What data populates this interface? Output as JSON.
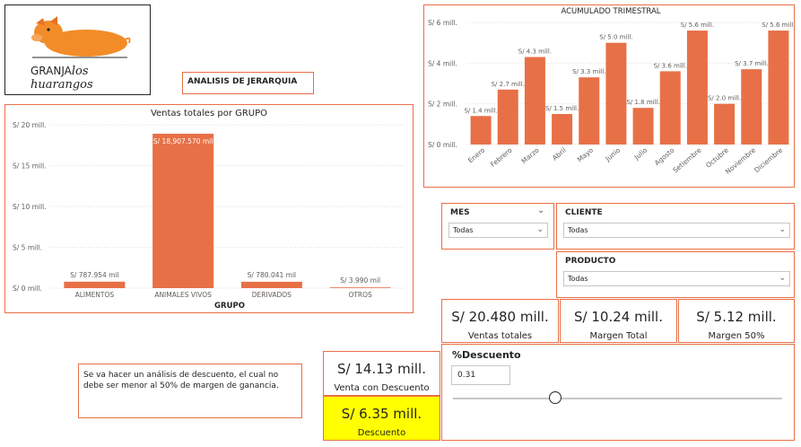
{
  "logo": {
    "brand_prefix": "GRANJA",
    "brand_name": "los huarangos"
  },
  "heading": "ANALISIS DE JERARQUIA",
  "bar_chart_grupo": {
    "title": "Ventas totales por GRUPO",
    "xlabel": "GRUPO",
    "y_ticks": [
      "S/ 0 mill.",
      "S/ 5 mill.",
      "S/ 10 mill.",
      "S/ 15 mill.",
      "S/ 20 mill."
    ],
    "data_labels": [
      "S/ 787.954 mil",
      "S/ 18,907.570 mil",
      "S/ 780.041 mil",
      "S/ 3.990 mil"
    ]
  },
  "bar_chart_mes": {
    "title": "ACUMULADO TRIMESTRAL",
    "y_ticks": [
      "S/ 0 mill.",
      "S/ 2 mill.",
      "S/ 4 mill.",
      "S/ 6 mill."
    ],
    "data_labels": [
      "S/ 1.4 mill.",
      "S/ 2.7 mill.",
      "S/ 4.3 mill.",
      "S/ 1.5 mill.",
      "S/ 3.3 mill.",
      "S/ 5.0 mill.",
      "S/ 1.8 mill.",
      "S/ 3.6 mill.",
      "S/ 5.6 mill.",
      "S/ 2.0 mill.",
      "S/ 3.7 mill.",
      "S/ 5.6 mill."
    ]
  },
  "chart_data": [
    {
      "type": "bar",
      "title": "Ventas totales por GRUPO",
      "xlabel": "GRUPO",
      "ylabel": "",
      "categories": [
        "ALIMENTOS",
        "ANIMALES VIVOS",
        "DERIVADOS",
        "OTROS"
      ],
      "values": [
        0.787954,
        18.90757,
        0.780041,
        0.00399
      ],
      "unit": "S/ mill.",
      "ylim": [
        0,
        20
      ],
      "grid": true,
      "color": "#e87046"
    },
    {
      "type": "bar",
      "title": "ACUMULADO TRIMESTRAL",
      "xlabel": "",
      "ylabel": "",
      "categories": [
        "Enero",
        "Febrero",
        "Marzo",
        "Abril",
        "Mayo",
        "Junio",
        "Julio",
        "Agosto",
        "Setiembre",
        "Octubre",
        "Noviembre",
        "Diciembre"
      ],
      "values": [
        1.4,
        2.7,
        4.3,
        1.5,
        3.3,
        5.0,
        1.8,
        3.6,
        5.6,
        2.0,
        3.7,
        5.6
      ],
      "unit": "S/ mill.",
      "ylim": [
        0,
        6
      ],
      "grid": true,
      "color": "#e87046"
    }
  ],
  "slicers": {
    "mes": {
      "label": "MES",
      "value": "Todas"
    },
    "cliente": {
      "label": "CLIENTE",
      "value": "Todas"
    },
    "producto": {
      "label": "PRODUCTO",
      "value": "Todas"
    }
  },
  "kpis": {
    "ventas_totales": {
      "value": "S/ 20.480 mill.",
      "label": "Ventas totales"
    },
    "margen_total": {
      "value": "S/ 10.24 mill.",
      "label": "Margen Total"
    },
    "margen_50": {
      "value": "S/ 5.12 mill.",
      "label": "Margen 50%"
    },
    "venta_con_descuento": {
      "value": "S/ 14.13 mill.",
      "label": "Venta con Descuento"
    },
    "descuento": {
      "value": "S/ 6.35 mill.",
      "label": "Descuento"
    }
  },
  "descuento_param": {
    "label": "%Descuento",
    "value": "0.31",
    "slider_fraction": 0.31
  },
  "note": "Se va hacer un análisis de descuento, el cual no debe ser menor al 50% de margen de ganancia.",
  "colors": {
    "accent": "#e87046",
    "highlight": "#ffff00"
  }
}
